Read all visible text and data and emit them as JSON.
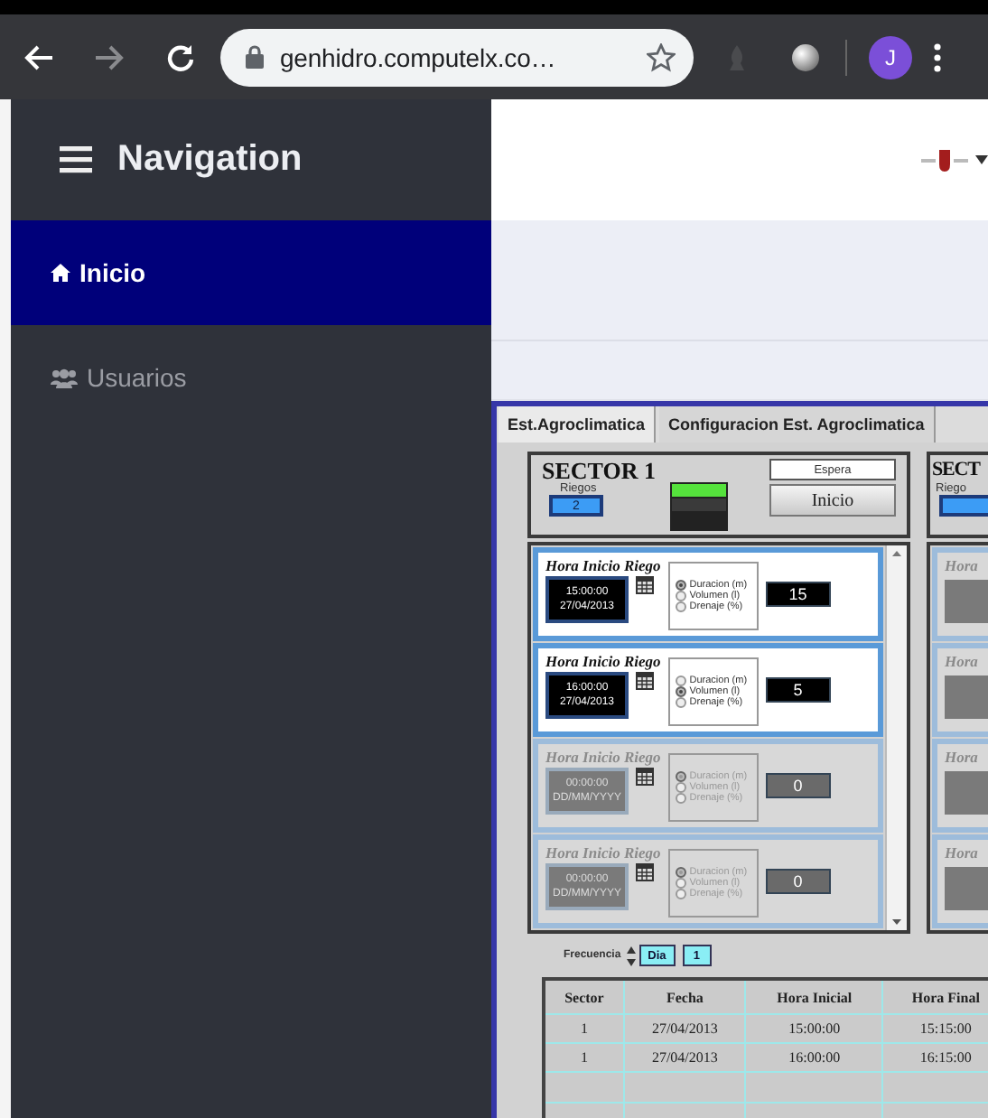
{
  "browser": {
    "url": "genhidro.computelx.co…",
    "profile_initial": "J"
  },
  "sidebar": {
    "title": "Navigation",
    "items": [
      {
        "label": "Inicio",
        "selected": true
      },
      {
        "label": "Usuarios",
        "selected": false
      }
    ]
  },
  "panel": {
    "tabs": [
      {
        "label": "Est.Agroclimatica",
        "selected": true
      },
      {
        "label": "Configuracion Est. Agroclimatica",
        "selected": false
      }
    ],
    "sector": {
      "title": "SECTOR 1",
      "riegos_label": "Riegos",
      "riegos": "2",
      "led_on": true,
      "status": "Espera",
      "start_button": "Inicio",
      "schedules": [
        {
          "title": "Hora Inicio Riego",
          "time": "15:00:00",
          "date": "27/04/2013",
          "enabled": true,
          "value": "15",
          "options": [
            {
              "label": "Duracion (m)",
              "selected": true
            },
            {
              "label": "Volumen (l)",
              "selected": false
            },
            {
              "label": "Drenaje (%)",
              "selected": false
            }
          ]
        },
        {
          "title": "Hora Inicio Riego",
          "time": "16:00:00",
          "date": "27/04/2013",
          "enabled": true,
          "value": "5",
          "options": [
            {
              "label": "Duracion (m)",
              "selected": false
            },
            {
              "label": "Volumen (l)",
              "selected": true
            },
            {
              "label": "Drenaje (%)",
              "selected": false
            }
          ]
        },
        {
          "title": "Hora Inicio Riego",
          "time": "00:00:00",
          "date": "DD/MM/YYYY",
          "enabled": false,
          "value": "0",
          "options": [
            {
              "label": "Duracion (m)",
              "selected": true
            },
            {
              "label": "Volumen (l)",
              "selected": false
            },
            {
              "label": "Drenaje (%)",
              "selected": false
            }
          ]
        },
        {
          "title": "Hora Inicio Riego",
          "time": "00:00:00",
          "date": "DD/MM/YYYY",
          "enabled": false,
          "value": "0",
          "options": [
            {
              "label": "Duracion (m)",
              "selected": true
            },
            {
              "label": "Volumen (l)",
              "selected": false
            },
            {
              "label": "Drenaje (%)",
              "selected": false
            }
          ]
        }
      ]
    },
    "next_sector": {
      "title": "SECT",
      "riegos_label": "Riego",
      "schedules": [
        {
          "title": "Hora"
        },
        {
          "title": "Hora"
        },
        {
          "title": "Hora"
        },
        {
          "title": "Hora"
        }
      ]
    },
    "frequency": {
      "label": "Frecuencia",
      "unit": "Dia",
      "value": "1"
    },
    "table": {
      "columns": [
        "Sector",
        "Fecha",
        "Hora Inicial",
        "Hora Final"
      ],
      "rows": [
        [
          "1",
          "27/04/2013",
          "15:00:00",
          "15:15:00"
        ],
        [
          "1",
          "27/04/2013",
          "16:00:00",
          "16:15:00"
        ]
      ]
    }
  }
}
